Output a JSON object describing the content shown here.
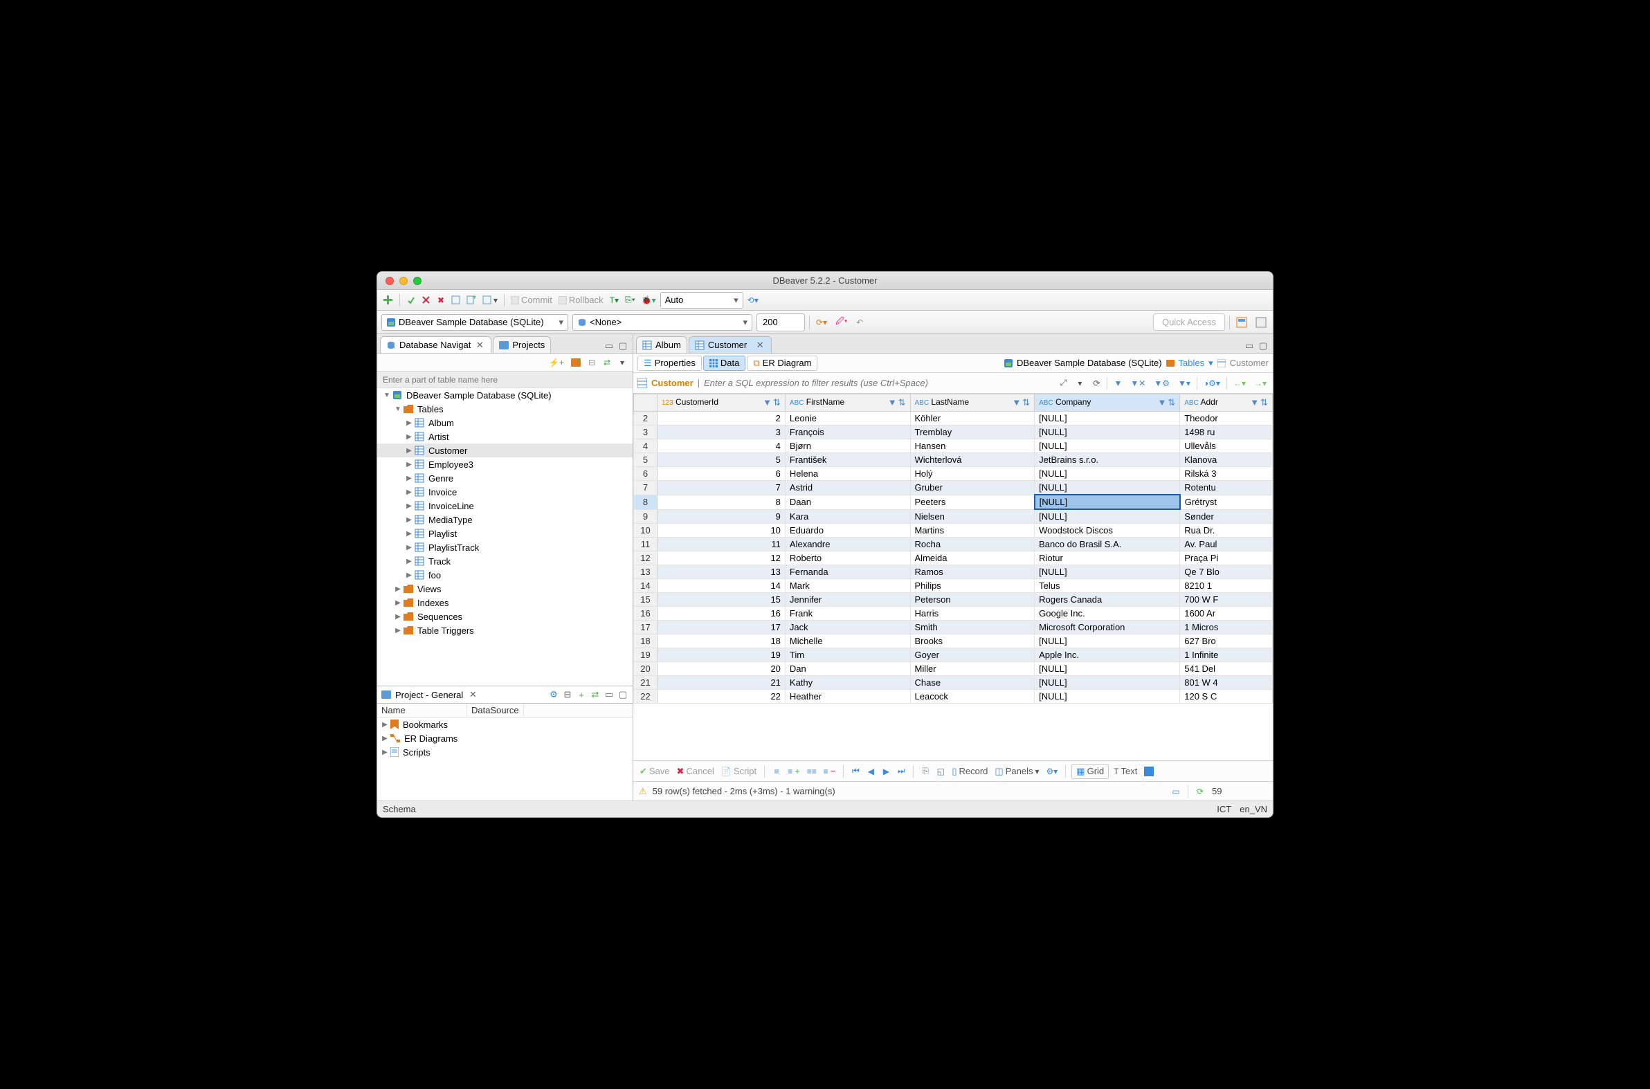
{
  "window_title": "DBeaver 5.2.2 - Customer",
  "toolbar": {
    "commit": "Commit",
    "rollback": "Rollback",
    "tx_mode": "Auto",
    "quick_access": "Quick Access"
  },
  "connbar": {
    "datasource": "DBeaver Sample Database (SQLite)",
    "schema": "<None>",
    "limit": "200"
  },
  "left_tabs": {
    "navigator": "Database Navigat",
    "projects": "Projects"
  },
  "nav_search_placeholder": "Enter a part of table name here",
  "tree": [
    {
      "d": 0,
      "exp": "down",
      "icon": "db",
      "label": "DBeaver Sample Database (SQLite)"
    },
    {
      "d": 1,
      "exp": "down",
      "icon": "folder-tables",
      "label": "Tables",
      "color": "#e07c1e"
    },
    {
      "d": 2,
      "exp": "right",
      "icon": "table",
      "label": "Album"
    },
    {
      "d": 2,
      "exp": "right",
      "icon": "table",
      "label": "Artist"
    },
    {
      "d": 2,
      "exp": "right",
      "icon": "table",
      "label": "Customer",
      "sel": true
    },
    {
      "d": 2,
      "exp": "right",
      "icon": "table",
      "label": "Employee3"
    },
    {
      "d": 2,
      "exp": "right",
      "icon": "table",
      "label": "Genre"
    },
    {
      "d": 2,
      "exp": "right",
      "icon": "table",
      "label": "Invoice"
    },
    {
      "d": 2,
      "exp": "right",
      "icon": "table",
      "label": "InvoiceLine"
    },
    {
      "d": 2,
      "exp": "right",
      "icon": "table",
      "label": "MediaType"
    },
    {
      "d": 2,
      "exp": "right",
      "icon": "table",
      "label": "Playlist"
    },
    {
      "d": 2,
      "exp": "right",
      "icon": "table",
      "label": "PlaylistTrack"
    },
    {
      "d": 2,
      "exp": "right",
      "icon": "table",
      "label": "Track"
    },
    {
      "d": 2,
      "exp": "right",
      "icon": "table",
      "label": "foo"
    },
    {
      "d": 1,
      "exp": "right",
      "icon": "folder-views",
      "label": "Views",
      "color": "#e07c1e"
    },
    {
      "d": 1,
      "exp": "right",
      "icon": "folder",
      "label": "Indexes",
      "color": "#e07c1e"
    },
    {
      "d": 1,
      "exp": "right",
      "icon": "folder",
      "label": "Sequences",
      "color": "#e07c1e"
    },
    {
      "d": 1,
      "exp": "right",
      "icon": "folder",
      "label": "Table Triggers",
      "color": "#e07c1e"
    }
  ],
  "project_panel": {
    "title": "Project - General",
    "col1": "Name",
    "col2": "DataSource",
    "items": [
      {
        "icon": "bookmark",
        "label": "Bookmarks",
        "color": "#e07c1e"
      },
      {
        "icon": "er",
        "label": "ER Diagrams",
        "color": "#e07c1e"
      },
      {
        "icon": "script",
        "label": "Scripts",
        "color": "#3b8ad8"
      }
    ]
  },
  "editor_tabs": [
    {
      "label": "Album",
      "active": false
    },
    {
      "label": "Customer",
      "active": true
    }
  ],
  "subtabs": {
    "properties": "Properties",
    "data": "Data",
    "er": "ER Diagram"
  },
  "breadcrumb": {
    "ds": "DBeaver Sample Database (SQLite)",
    "tables": "Tables",
    "table": "Customer"
  },
  "filter": {
    "table": "Customer",
    "placeholder": "Enter a SQL expression to filter results (use Ctrl+Space)"
  },
  "columns": [
    "CustomerId",
    "FirstName",
    "LastName",
    "Company",
    "Addr"
  ],
  "col_types": [
    "num",
    "abc",
    "abc",
    "abc",
    "abc"
  ],
  "rows": [
    {
      "n": 2,
      "id": 2,
      "first": "Leonie",
      "last": "Köhler",
      "company": "[NULL]",
      "addr": "Theodor"
    },
    {
      "n": 3,
      "id": 3,
      "first": "François",
      "last": "Tremblay",
      "company": "[NULL]",
      "addr": "1498 ru"
    },
    {
      "n": 4,
      "id": 4,
      "first": "Bjørn",
      "last": "Hansen",
      "company": "[NULL]",
      "addr": "Ullevåls"
    },
    {
      "n": 5,
      "id": 5,
      "first": "František",
      "last": "Wichterlová",
      "company": "JetBrains s.r.o.",
      "addr": "Klanova"
    },
    {
      "n": 6,
      "id": 6,
      "first": "Helena",
      "last": "Holý",
      "company": "[NULL]",
      "addr": "Rilská 3"
    },
    {
      "n": 7,
      "id": 7,
      "first": "Astrid",
      "last": "Gruber",
      "company": "[NULL]",
      "addr": "Rotentu"
    },
    {
      "n": 8,
      "id": 8,
      "first": "Daan",
      "last": "Peeters",
      "company": "[NULL]",
      "addr": "Grétryst",
      "sel": true
    },
    {
      "n": 9,
      "id": 9,
      "first": "Kara",
      "last": "Nielsen",
      "company": "[NULL]",
      "addr": "Sønder"
    },
    {
      "n": 10,
      "id": 10,
      "first": "Eduardo",
      "last": "Martins",
      "company": "Woodstock Discos",
      "addr": "Rua Dr."
    },
    {
      "n": 11,
      "id": 11,
      "first": "Alexandre",
      "last": "Rocha",
      "company": "Banco do Brasil S.A.",
      "addr": "Av. Paul"
    },
    {
      "n": 12,
      "id": 12,
      "first": "Roberto",
      "last": "Almeida",
      "company": "Riotur",
      "addr": "Praça Pi"
    },
    {
      "n": 13,
      "id": 13,
      "first": "Fernanda",
      "last": "Ramos",
      "company": "[NULL]",
      "addr": "Qe 7 Blo"
    },
    {
      "n": 14,
      "id": 14,
      "first": "Mark",
      "last": "Philips",
      "company": "Telus",
      "addr": "8210 1"
    },
    {
      "n": 15,
      "id": 15,
      "first": "Jennifer",
      "last": "Peterson",
      "company": "Rogers Canada",
      "addr": "700 W F"
    },
    {
      "n": 16,
      "id": 16,
      "first": "Frank",
      "last": "Harris",
      "company": "Google Inc.",
      "addr": "1600 Ar"
    },
    {
      "n": 17,
      "id": 17,
      "first": "Jack",
      "last": "Smith",
      "company": "Microsoft Corporation",
      "addr": "1 Micros"
    },
    {
      "n": 18,
      "id": 18,
      "first": "Michelle",
      "last": "Brooks",
      "company": "[NULL]",
      "addr": "627 Bro"
    },
    {
      "n": 19,
      "id": 19,
      "first": "Tim",
      "last": "Goyer",
      "company": "Apple Inc.",
      "addr": "1 Infinite"
    },
    {
      "n": 20,
      "id": 20,
      "first": "Dan",
      "last": "Miller",
      "company": "[NULL]",
      "addr": "541 Del"
    },
    {
      "n": 21,
      "id": 21,
      "first": "Kathy",
      "last": "Chase",
      "company": "[NULL]",
      "addr": "801 W 4"
    },
    {
      "n": 22,
      "id": 22,
      "first": "Heather",
      "last": "Leacock",
      "company": "[NULL]",
      "addr": "120 S C"
    }
  ],
  "bottom": {
    "save": "Save",
    "cancel": "Cancel",
    "script": "Script",
    "record": "Record",
    "panels": "Panels",
    "grid": "Grid",
    "text": "Text"
  },
  "status": {
    "fetch": "59 row(s) fetched - 2ms (+3ms) - 1 warning(s)",
    "count": "59"
  },
  "footer": {
    "schema": "Schema",
    "tz": "ICT",
    "locale": "en_VN"
  }
}
